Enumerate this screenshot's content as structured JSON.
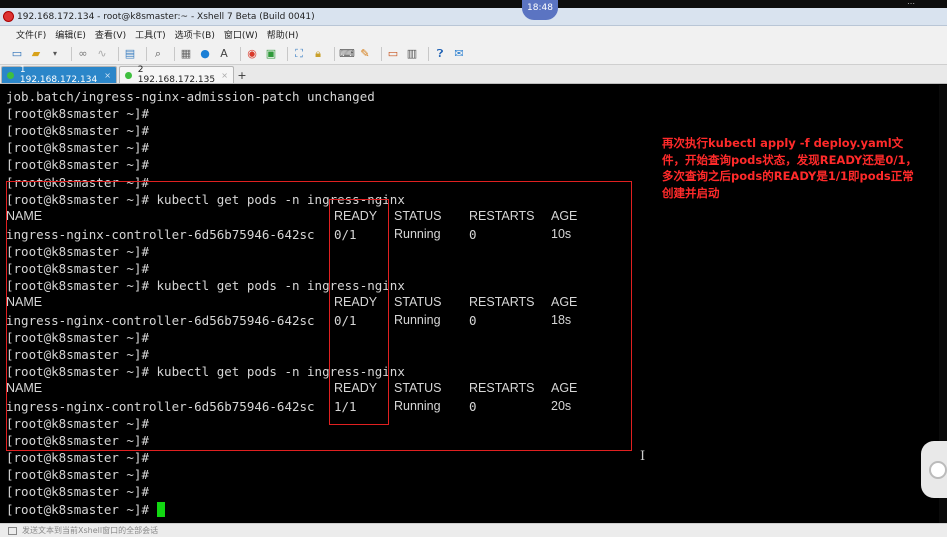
{
  "clock": "18:48",
  "window": {
    "title": "192.168.172.134 - root@k8smaster:~ - Xshell 7 Beta (Build 0041)"
  },
  "menu": [
    "文件(F)",
    "编辑(E)",
    "查看(V)",
    "工具(T)",
    "选项卡(B)",
    "窗口(W)",
    "帮助(H)"
  ],
  "toolbar_icons": [
    "new-session-icon",
    "open-folder-icon",
    "dropdown-icon",
    "link-icon",
    "unlink-icon",
    "properties-icon",
    "find-icon",
    "script-icon",
    "globe-icon",
    "font-icon",
    "color-icon",
    "transfer-icon",
    "fullscreen-icon",
    "lock-icon",
    "keyboard-icon",
    "highlight-icon",
    "compose-icon",
    "layout-icon",
    "help-icon",
    "chat-icon"
  ],
  "tabs": [
    {
      "label": "1 192.168.172.134",
      "active": true,
      "close": "×"
    },
    {
      "label": "2 192.168.172.135",
      "active": false,
      "close": "×"
    }
  ],
  "tab_add": "+",
  "terminal": {
    "lines": [
      "job.batch/ingress-nginx-admission-patch unchanged",
      "[root@k8smaster ~]#",
      "[root@k8smaster ~]#",
      "[root@k8smaster ~]#",
      "[root@k8smaster ~]#",
      "[root@k8smaster ~]#",
      "[root@k8smaster ~]# kubectl get pods -n ingress-nginx",
      "",
      "",
      "[root@k8smaster ~]#",
      "[root@k8smaster ~]#",
      "[root@k8smaster ~]# kubectl get pods -n ingress-nginx",
      "",
      "",
      "[root@k8smaster ~]#",
      "[root@k8smaster ~]#",
      "[root@k8smaster ~]# kubectl get pods -n ingress-nginx",
      "",
      "",
      "[root@k8smaster ~]#",
      "[root@k8smaster ~]#",
      "[root@k8smaster ~]#",
      "[root@k8smaster ~]#",
      "[root@k8smaster ~]#",
      "[root@k8smaster ~]#"
    ],
    "tables": [
      {
        "headers": [
          "NAME",
          "READY",
          "STATUS",
          "RESTARTS",
          "AGE"
        ],
        "row": [
          "ingress-nginx-controller-6d56b75946-642sc",
          "0/1",
          "Running",
          "0",
          "10s"
        ]
      },
      {
        "headers": [
          "NAME",
          "READY",
          "STATUS",
          "RESTARTS",
          "AGE"
        ],
        "row": [
          "ingress-nginx-controller-6d56b75946-642sc",
          "0/1",
          "Running",
          "0",
          "18s"
        ]
      },
      {
        "headers": [
          "NAME",
          "READY",
          "STATUS",
          "RESTARTS",
          "AGE"
        ],
        "row": [
          "ingress-nginx-controller-6d56b75946-642sc",
          "1/1",
          "Running",
          "0",
          "20s"
        ]
      }
    ]
  },
  "annotation": {
    "text": "再次执行kubectl  apply -f deploy.yaml文件，开始查询pods状态，发现READY还是0/1，多次查询之后pods的READY是1/1即pods正常创建并启动",
    "color": "#ff2a2a"
  },
  "statusbar": {
    "text": "发送文本到当前Xshell窗口的全部会话"
  }
}
